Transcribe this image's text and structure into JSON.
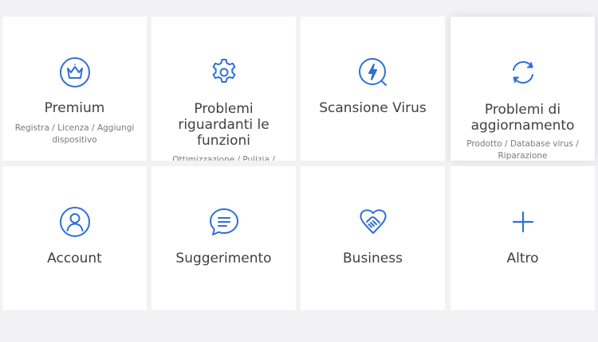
{
  "accent_color": "#2f6fd8",
  "cards": [
    {
      "id": "premium",
      "title": "Premium",
      "subtitle": "Registra / Licenza / Aggiungi dispositivo",
      "icon": "crown-icon"
    },
    {
      "id": "problems",
      "title": "Problemi riguardanti le funzioni",
      "subtitle": "Ottimizzazione / Pulizia /",
      "icon": "gear-icon"
    },
    {
      "id": "virus",
      "title": "Scansione Virus",
      "subtitle": "",
      "icon": "lightning-scan-icon"
    },
    {
      "id": "update",
      "title": "Problemi di aggiornamento",
      "subtitle": "Prodotto / Database virus / Riparazione",
      "icon": "refresh-icon"
    },
    {
      "id": "account",
      "title": "Account",
      "subtitle": "",
      "icon": "user-icon"
    },
    {
      "id": "suggest",
      "title": "Suggerimento",
      "subtitle": "",
      "icon": "chat-icon"
    },
    {
      "id": "business",
      "title": "Business",
      "subtitle": "",
      "icon": "handshake-icon"
    },
    {
      "id": "other",
      "title": "Altro",
      "subtitle": "",
      "icon": "plus-icon"
    }
  ]
}
